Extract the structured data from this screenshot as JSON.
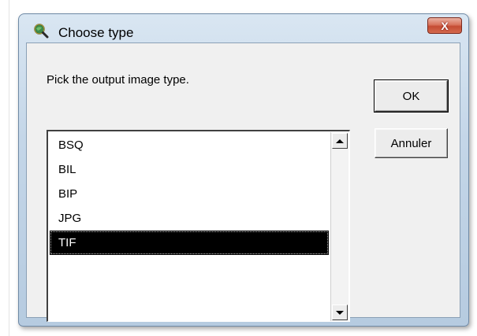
{
  "window": {
    "title": "Choose type",
    "close_glyph": "X",
    "icon": "magnifier-globe-icon"
  },
  "dialog": {
    "prompt": "Pick the output image type.",
    "ok_label": "OK",
    "cancel_label": "Annuler"
  },
  "list": {
    "items": [
      {
        "label": "BSQ"
      },
      {
        "label": "BIL"
      },
      {
        "label": "BIP"
      },
      {
        "label": "JPG"
      },
      {
        "label": "TIF"
      }
    ],
    "selected_index": 4
  },
  "colors": {
    "selection_bg": "#000000",
    "close_button": "#c44c33",
    "window_frame": "#b6cbe0"
  }
}
